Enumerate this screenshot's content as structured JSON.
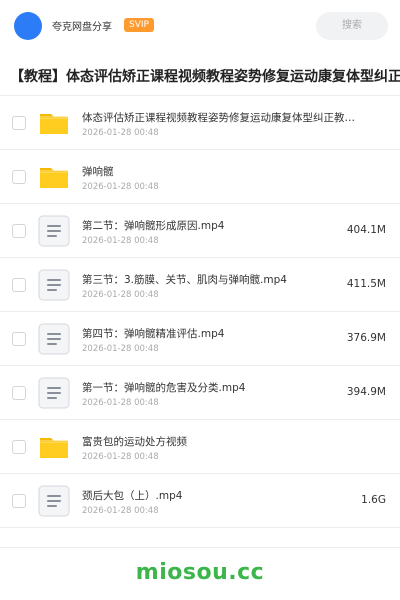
{
  "header": {
    "owner_name": "夸克网盘分享",
    "badge": "SVIP",
    "search_label": "搜索",
    "avatar_color": "#2b7cf6",
    "badge_color": "#ff9a2e"
  },
  "share_title": "【教程】体态评估矫正课程视频教程姿势修复运动康复体型纠正",
  "files": [
    {
      "type": "folder",
      "name": "体态评估矫正课程视频教程姿势修复运动康复体型纠正教…",
      "date": "2026-01-28 00:48",
      "size": ""
    },
    {
      "type": "folder",
      "name": "弹响髋",
      "date": "2026-01-28 00:48",
      "size": ""
    },
    {
      "type": "video",
      "name": "第二节：弹响髋形成原因.mp4",
      "date": "2026-01-28 00:48",
      "size": "404.1M"
    },
    {
      "type": "video",
      "name": "第三节：3.筋膜、关节、肌肉与弹响髋.mp4",
      "date": "2026-01-28 00:48",
      "size": "411.5M"
    },
    {
      "type": "video",
      "name": "第四节：弹响髋精准评估.mp4",
      "date": "2026-01-28 00:48",
      "size": "376.9M"
    },
    {
      "type": "video",
      "name": "第一节：弹响髋的危害及分类.mp4",
      "date": "2026-01-28 00:48",
      "size": "394.9M"
    },
    {
      "type": "folder",
      "name": "富贵包的运动处方视频",
      "date": "2026-01-28 00:48",
      "size": ""
    },
    {
      "type": "video",
      "name": "颈后大包（上）.mp4",
      "date": "2026-01-28 00:48",
      "size": "1.6G"
    }
  ],
  "icons": {
    "folder": "folder-icon",
    "video": "file-doc-icon"
  },
  "watermark": "miosou.cc"
}
